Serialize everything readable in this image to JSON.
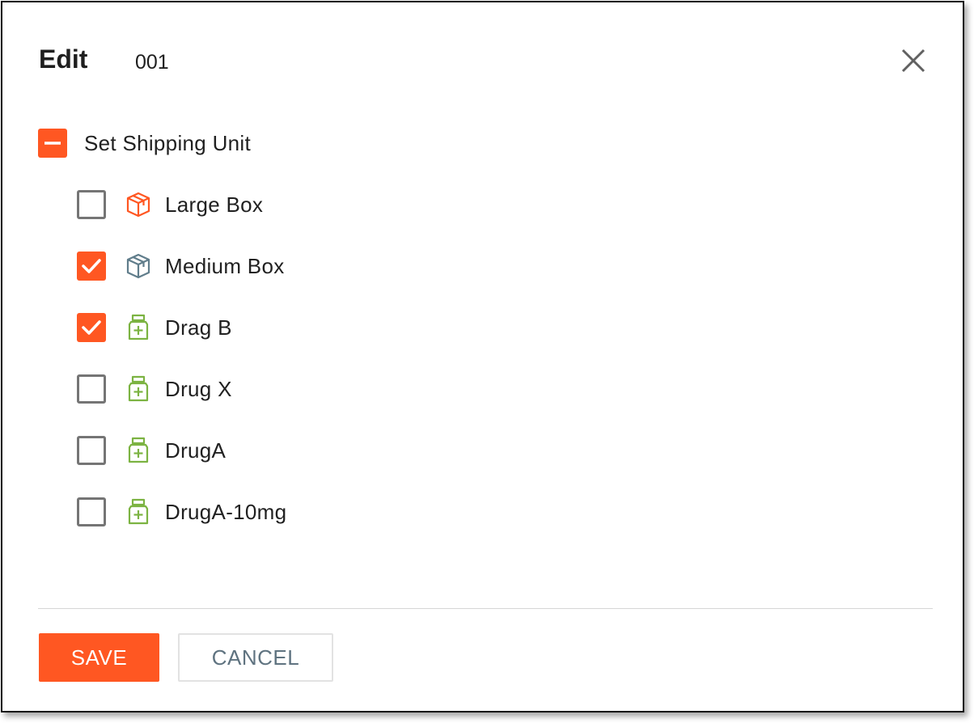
{
  "dialog": {
    "title": "Edit",
    "record_id": "001",
    "close_icon": "close-icon"
  },
  "group": {
    "label": "Set Shipping Unit",
    "state": "indeterminate",
    "items": [
      {
        "label": "Large Box",
        "checked": false,
        "icon": "box-icon"
      },
      {
        "label": "Medium Box",
        "checked": true,
        "icon": "box-icon"
      },
      {
        "label": "Drag B",
        "checked": true,
        "icon": "medicine-bottle-icon"
      },
      {
        "label": "Drug X",
        "checked": false,
        "icon": "medicine-bottle-icon"
      },
      {
        "label": "DrugA",
        "checked": false,
        "icon": "medicine-bottle-icon"
      },
      {
        "label": "DrugA-10mg",
        "checked": false,
        "icon": "medicine-bottle-icon"
      }
    ]
  },
  "actions": {
    "save_label": "SAVE",
    "cancel_label": "CANCEL"
  },
  "colors": {
    "accent": "#ff5722",
    "large_box_icon": "#ff5722",
    "medium_box_icon": "#607d8b",
    "drug_icon": "#7cb342"
  }
}
